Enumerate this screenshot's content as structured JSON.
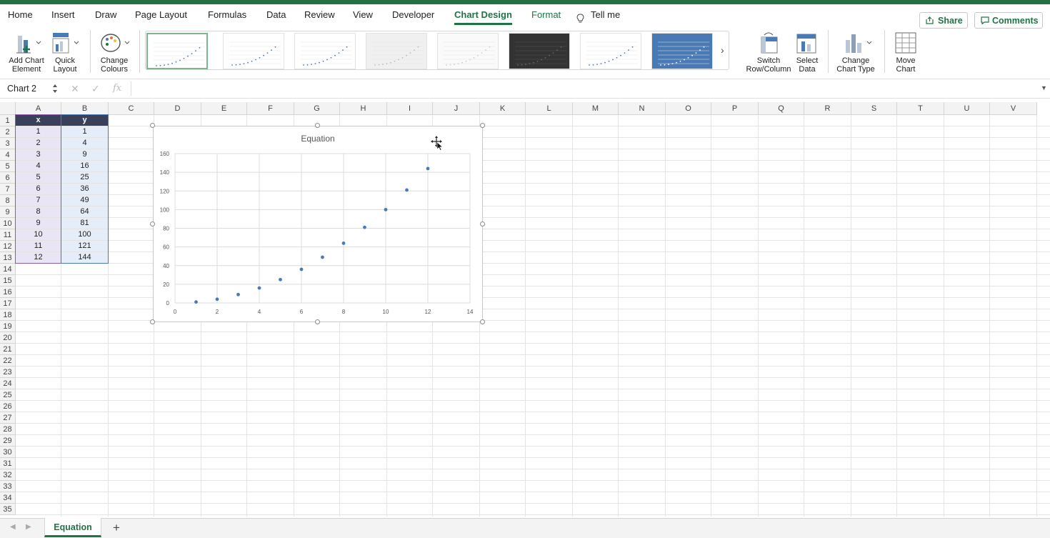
{
  "ribbon_tabs": [
    "Home",
    "Insert",
    "Draw",
    "Page Layout",
    "Formulas",
    "Data",
    "Review",
    "View",
    "Developer",
    "Chart Design",
    "Format",
    "Tell me"
  ],
  "active_tab": "Chart Design",
  "header_buttons": {
    "share": "Share",
    "comments": "Comments"
  },
  "ribbon": {
    "add_chart_element": [
      "Add Chart",
      "Element"
    ],
    "quick_layout": [
      "Quick",
      "Layout"
    ],
    "change_colours": [
      "Change",
      "Colours"
    ],
    "switch_row_column": [
      "Switch",
      "Row/Column"
    ],
    "select_data": [
      "Select",
      "Data"
    ],
    "change_chart_type": [
      "Change",
      "Chart Type"
    ],
    "move_chart": [
      "Move",
      "Chart"
    ],
    "chart_styles_count": 8,
    "selected_style_index": 0
  },
  "formula_bar": {
    "name_box": "Chart 2",
    "fx": "fx",
    "formula": ""
  },
  "columns": [
    "A",
    "B",
    "C",
    "D",
    "E",
    "F",
    "G",
    "H",
    "I",
    "J",
    "K",
    "L",
    "M",
    "N",
    "O",
    "P",
    "Q",
    "R",
    "S",
    "T",
    "U",
    "V"
  ],
  "rows": [
    "1",
    "2",
    "3",
    "4",
    "5",
    "6",
    "7",
    "8",
    "9",
    "10",
    "11",
    "12",
    "13",
    "14",
    "15",
    "16",
    "17",
    "18",
    "19",
    "20",
    "21",
    "22",
    "23",
    "24",
    "25",
    "26",
    "27",
    "28",
    "29",
    "30",
    "31",
    "32",
    "33",
    "34",
    "35"
  ],
  "table": {
    "headers": [
      "x",
      "y"
    ],
    "x": [
      "1",
      "2",
      "3",
      "4",
      "5",
      "6",
      "7",
      "8",
      "9",
      "10",
      "11",
      "12"
    ],
    "y": [
      "1",
      "4",
      "9",
      "16",
      "25",
      "36",
      "49",
      "64",
      "81",
      "100",
      "121",
      "144"
    ]
  },
  "chart_data": {
    "type": "scatter",
    "title": "Equation",
    "x": [
      1,
      2,
      3,
      4,
      5,
      6,
      7,
      8,
      9,
      10,
      11,
      12
    ],
    "y": [
      1,
      4,
      9,
      16,
      25,
      36,
      49,
      64,
      81,
      100,
      121,
      144
    ],
    "xlim": [
      0,
      14
    ],
    "ylim": [
      0,
      160
    ],
    "xticks": [
      "0",
      "2",
      "4",
      "6",
      "8",
      "10",
      "12",
      "14"
    ],
    "yticks": [
      "0",
      "20",
      "40",
      "60",
      "80",
      "100",
      "120",
      "140",
      "160"
    ],
    "grid": true,
    "marker_color": "#4a7ab5"
  },
  "sheets": [
    "Equation"
  ],
  "colors": {
    "accent": "#217346",
    "header_fill": "#3a3f5a"
  }
}
